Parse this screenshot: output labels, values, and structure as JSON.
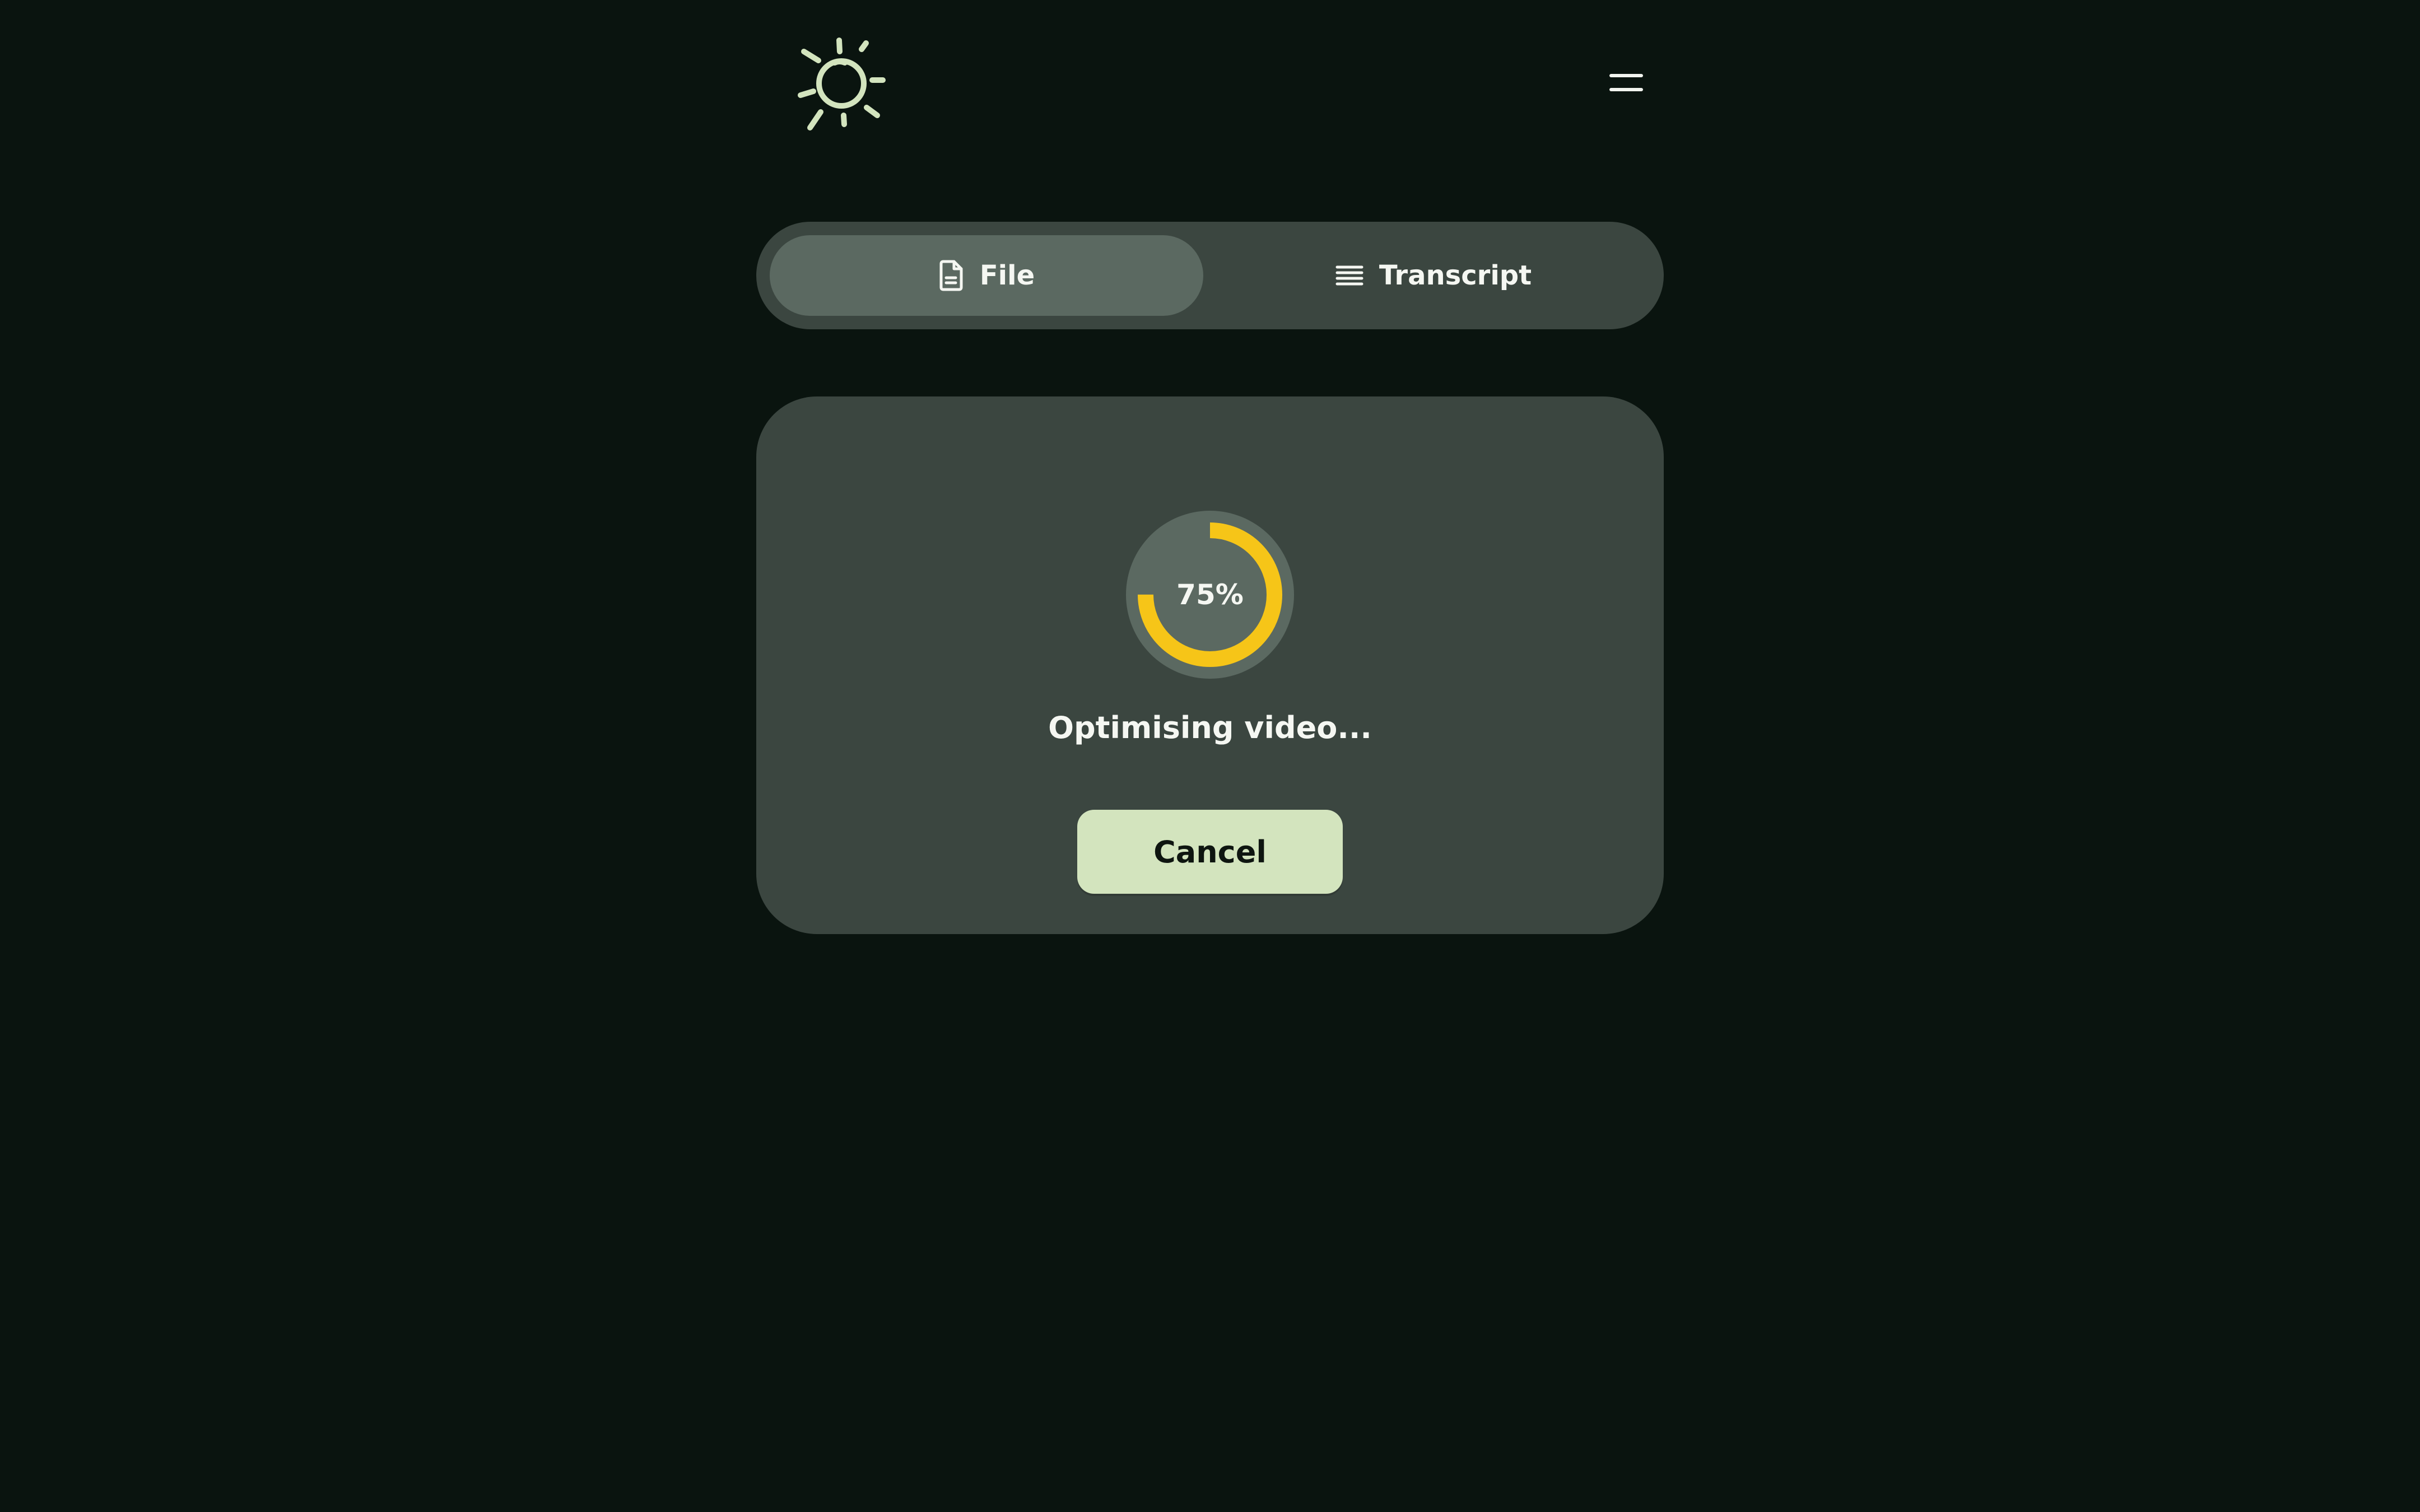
{
  "logo": {
    "icon": "sun-logo-icon",
    "color": "#d3e4be"
  },
  "menu": {
    "icon": "hamburger-menu-icon"
  },
  "tabs": [
    {
      "label": "File",
      "icon": "file-icon",
      "active": true
    },
    {
      "label": "Transcript",
      "icon": "lines-icon",
      "active": false
    }
  ],
  "progress": {
    "percent": 75,
    "label": "75%",
    "status": "Optimising video...",
    "ring_color": "#f6c518",
    "track_color": "#5b6961"
  },
  "actions": {
    "cancel_label": "Cancel"
  },
  "colors": {
    "background": "#0a140f",
    "panel": "#3b4640",
    "active_tab": "#5b6961",
    "button": "#d3e4be"
  }
}
